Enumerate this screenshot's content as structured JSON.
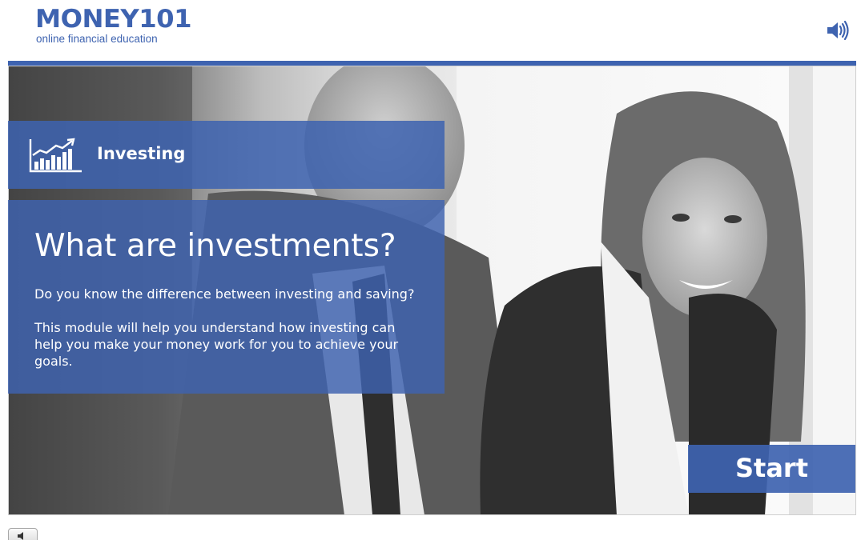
{
  "brand": {
    "logo_text": "MONEY101",
    "tagline": "online financial education",
    "brand_color": "#3e63b0"
  },
  "header": {
    "sound_icon": "speaker-volume-icon"
  },
  "module": {
    "category_icon": "growth-chart-icon",
    "category_label": "Investing",
    "heading": "What are investments?",
    "paragraph_1": "Do you know the difference between investing and saving?",
    "paragraph_2": "This module will help you understand how investing can help you make your money work for you to achieve your goals."
  },
  "actions": {
    "start_label": "Start"
  },
  "footer": {
    "mute_icon": "speaker-icon"
  }
}
